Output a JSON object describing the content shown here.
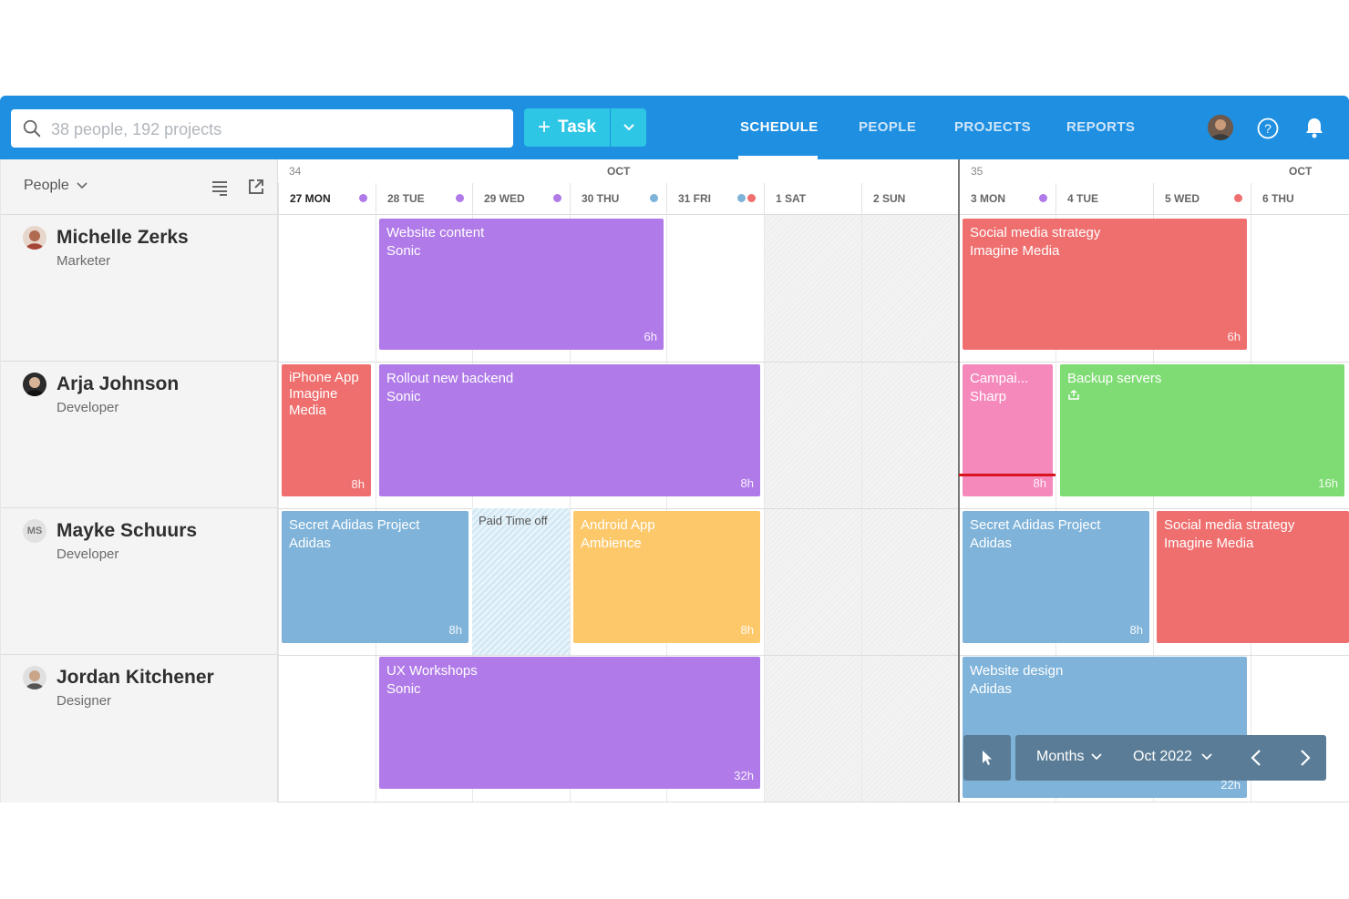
{
  "search": {
    "placeholder": "38 people, 192 projects"
  },
  "task_button": {
    "label": "Task"
  },
  "nav": [
    {
      "label": "SCHEDULE",
      "active": true
    },
    {
      "label": "PEOPLE",
      "active": false
    },
    {
      "label": "PROJECTS",
      "active": false
    },
    {
      "label": "REPORTS",
      "active": false
    }
  ],
  "left_panel": {
    "people_dropdown": "People"
  },
  "people": [
    {
      "name": "Michelle Zerks",
      "role": "Marketer"
    },
    {
      "name": "Arja Johnson",
      "role": "Developer"
    },
    {
      "name": "Mayke Schuurs",
      "role": "Developer",
      "initials": "MS"
    },
    {
      "name": "Jordan Kitchener",
      "role": "Designer"
    }
  ],
  "weeks": [
    {
      "number": "34",
      "month": "OCT"
    },
    {
      "number": "35",
      "month": "OCT"
    }
  ],
  "days": [
    {
      "label": "27 MON",
      "today": true,
      "dots": [
        "#b07ae8"
      ]
    },
    {
      "label": "28 TUE",
      "dots": [
        "#b07ae8"
      ]
    },
    {
      "label": "29 WED",
      "dots": [
        "#b07ae8"
      ]
    },
    {
      "label": "30 THU",
      "dots": [
        "#7fb3d9"
      ]
    },
    {
      "label": "31 FRI",
      "dots": [
        "#7fb3d9",
        "#ef6f6f"
      ]
    },
    {
      "label": "1 SAT",
      "dots": []
    },
    {
      "label": "2 SUN",
      "dots": []
    },
    {
      "label": "3 MON",
      "dots": [
        "#b07ae8"
      ]
    },
    {
      "label": "4 TUE",
      "dots": []
    },
    {
      "label": "5 WED",
      "dots": [
        "#ef6f6f"
      ]
    },
    {
      "label": "6 THU",
      "dots": []
    }
  ],
  "tasks": {
    "michelle_1": {
      "title": "Website content",
      "project": "Sonic",
      "hours": "6h",
      "color": "#b07ae8"
    },
    "michelle_2": {
      "title": "Social media strategy",
      "project": "Imagine Media",
      "hours": "6h",
      "color": "#ef6f6f"
    },
    "arja_1": {
      "title": "iPhone App",
      "project": "Imagine Media",
      "hours": "8h",
      "color": "#ef6f6f"
    },
    "arja_2": {
      "title": "Rollout new backend",
      "project": "Sonic",
      "hours": "8h",
      "color": "#b07ae8"
    },
    "arja_3": {
      "title": "Campai...",
      "project": "Sharp",
      "hours": "8h",
      "color": "#f589bb"
    },
    "arja_4": {
      "title": "Backup servers",
      "project": "",
      "hours": "16h",
      "color": "#7fdc74"
    },
    "mayke_1": {
      "title": "Secret Adidas Project",
      "project": "Adidas",
      "hours": "8h",
      "color": "#7fb3d9"
    },
    "mayke_pto": {
      "title": "Paid Time off"
    },
    "mayke_2": {
      "title": "Android App",
      "project": "Ambience",
      "hours": "8h",
      "color": "#fdc86a"
    },
    "mayke_3": {
      "title": "Secret Adidas Project",
      "project": "Adidas",
      "hours": "8h",
      "color": "#7fb3d9"
    },
    "mayke_4": {
      "title": "Social media strategy",
      "project": "Imagine Media",
      "hours": "",
      "color": "#ef6f6f"
    },
    "jordan_1": {
      "title": "UX Workshops",
      "project": "Sonic",
      "hours": "32h",
      "color": "#b07ae8"
    },
    "jordan_2": {
      "title": "Website design",
      "project": "Adidas",
      "hours": "22h",
      "color": "#7fb3d9"
    }
  },
  "controls": {
    "view": "Months",
    "date": "Oct 2022"
  }
}
